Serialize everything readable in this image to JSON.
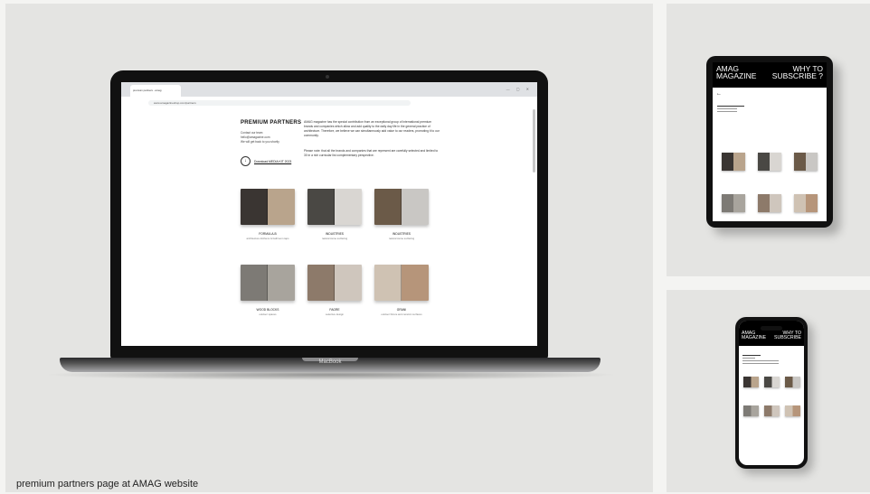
{
  "caption": "premium partners page at AMAG website",
  "laptop": {
    "brand": "MacBook",
    "tab_title": "premium partners - amag",
    "url": "www.amagazineshop.com/partners",
    "page": {
      "title": "PREMIUM PARTNERS",
      "contact_lines": [
        "Contact our team",
        "hello@amagazine.com",
        "We will get back to you shortly"
      ],
      "download_label": "Download MEDIA KIT 2023",
      "intro": "AMAG magazine has the special contribution from an exceptional group of international premium brands and companies which allow and add quality to the daily day life in the general practice of architecture. Therefore, we believe we can simultaneously add value to our readers, promoting it to our community.",
      "note": "Please note: that all the brands and companies that are represent are carefully selected and limited to 30 in a rich curricular list complementary perspective.",
      "magazines": [
        {
          "name": "FORMULA-B",
          "sub": "architecture kitchens & bathroom taps",
          "colors": [
            "#3a3532",
            "#b9a48c"
          ]
        },
        {
          "name": "INDUSTRIES",
          "sub": "natural stone surfacing",
          "colors": [
            "#4a4844",
            "#d9d6d2"
          ]
        },
        {
          "name": "INDUSTRIES",
          "sub": "natural stone surfacing",
          "colors": [
            "#6b5a48",
            "#c9c7c4"
          ]
        },
        {
          "name": "WOOD BLOCKS",
          "sub": "outdoor spaces",
          "colors": [
            "#7d7a75",
            "#a8a49d"
          ]
        },
        {
          "name": "FAGRE",
          "sub": "selective design",
          "colors": [
            "#8d7a6a",
            "#cfc6bd"
          ]
        },
        {
          "name": "GRANI",
          "sub": "outdoor fixture and ceramic surfaces",
          "colors": [
            "#cfc2b3",
            "#b6957a"
          ]
        }
      ]
    }
  },
  "tablet": {
    "head_left": [
      "AMAG",
      "MAGAZINE"
    ],
    "head_right": [
      "WHY TO",
      "SUBSCRIBE ?"
    ]
  },
  "phone": {
    "head_left": [
      "AMAG",
      "MAGAZINE"
    ],
    "head_right": [
      "WHY TO",
      "SUBSCRIBE"
    ]
  }
}
